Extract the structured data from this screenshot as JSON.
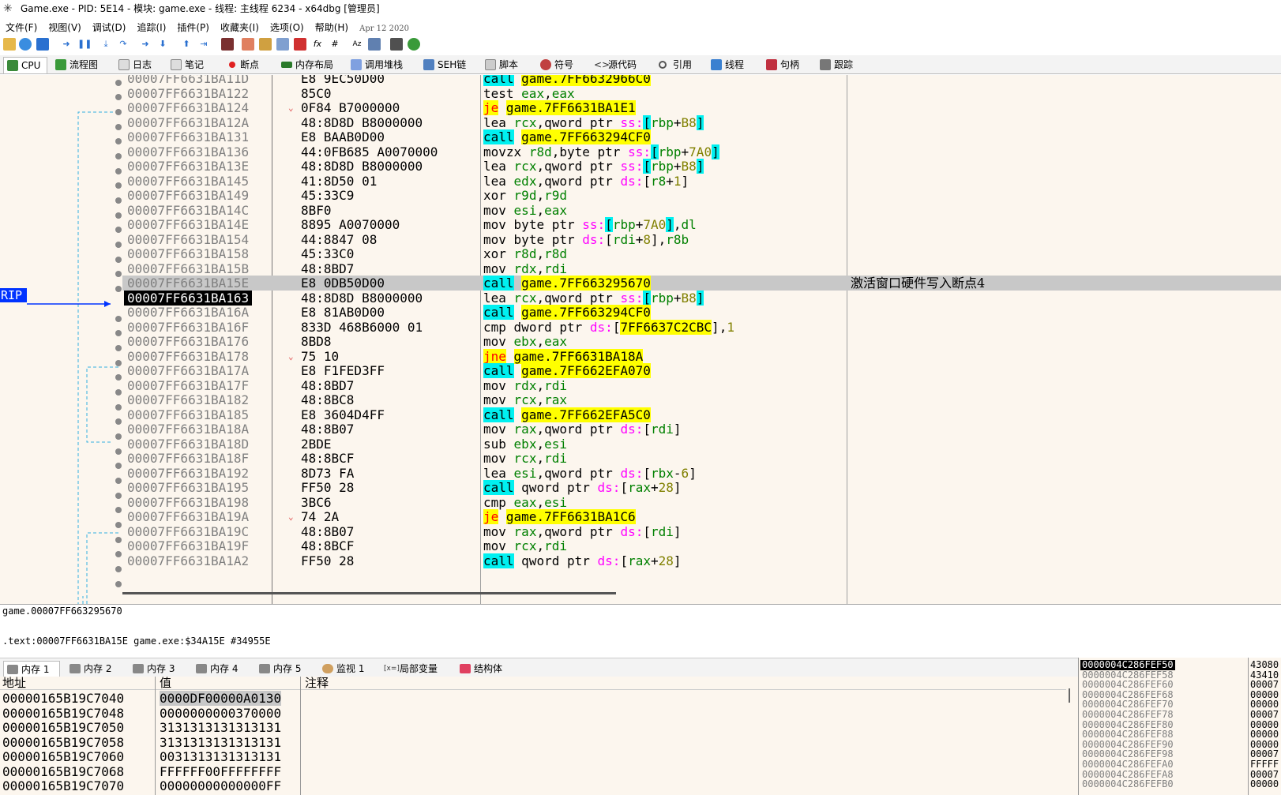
{
  "window": {
    "title": "Game.exe - PID: 5E14 - 模块: game.exe - 线程: 主线程 6234 - x64dbg [管理员]"
  },
  "menu": {
    "items": [
      "文件(F)",
      "视图(V)",
      "调试(D)",
      "追踪(I)",
      "插件(P)",
      "收藏夹(I)",
      "选项(O)",
      "帮助(H)"
    ],
    "date": "Apr 12 2020"
  },
  "tabs": [
    "CPU",
    "流程图",
    "日志",
    "笔记",
    "断点",
    "内存布局",
    "调用堆栈",
    "SEH链",
    "脚本",
    "符号",
    "源代码",
    "引用",
    "线程",
    "句柄",
    "跟踪"
  ],
  "rip_label": "RIP",
  "disasm": [
    {
      "addr": "00007FF6631BA11D",
      "bytes": "E8 9EC50D00",
      "mn": "call",
      "op": "game.7FF6632966C0",
      "kind": "call"
    },
    {
      "addr": "00007FF6631BA122",
      "bytes": "85C0",
      "mn": "test",
      "op": "eax,eax",
      "kind": "plain"
    },
    {
      "addr": "00007FF6631BA124",
      "bytes": "0F84 B7000000",
      "mn": "je",
      "op": "game.7FF6631BA1E1",
      "kind": "jmp",
      "arrow": "v"
    },
    {
      "addr": "00007FF6631BA12A",
      "bytes": "48:8D8D B8000000",
      "mn": "lea",
      "op": "rcx,qword ptr ss:[rbp+B8]",
      "kind": "plain"
    },
    {
      "addr": "00007FF6631BA131",
      "bytes": "E8 BAAB0D00",
      "mn": "call",
      "op": "game.7FF663294CF0",
      "kind": "call"
    },
    {
      "addr": "00007FF6631BA136",
      "bytes": "44:0FB685 A0070000",
      "mn": "movzx",
      "op": "r8d,byte ptr ss:[rbp+7A0]",
      "kind": "plain"
    },
    {
      "addr": "00007FF6631BA13E",
      "bytes": "48:8D8D B8000000",
      "mn": "lea",
      "op": "rcx,qword ptr ss:[rbp+B8]",
      "kind": "plain"
    },
    {
      "addr": "00007FF6631BA145",
      "bytes": "41:8D50 01",
      "mn": "lea",
      "op": "edx,qword ptr ds:[r8+1]",
      "kind": "plain"
    },
    {
      "addr": "00007FF6631BA149",
      "bytes": "45:33C9",
      "mn": "xor",
      "op": "r9d,r9d",
      "kind": "plain"
    },
    {
      "addr": "00007FF6631BA14C",
      "bytes": "8BF0",
      "mn": "mov",
      "op": "esi,eax",
      "kind": "plain"
    },
    {
      "addr": "00007FF6631BA14E",
      "bytes": "8895 A0070000",
      "mn": "mov",
      "op": "byte ptr ss:[rbp+7A0],dl",
      "kind": "plain"
    },
    {
      "addr": "00007FF6631BA154",
      "bytes": "44:8847 08",
      "mn": "mov",
      "op": "byte ptr ds:[rdi+8],r8b",
      "kind": "plain"
    },
    {
      "addr": "00007FF6631BA158",
      "bytes": "45:33C0",
      "mn": "xor",
      "op": "r8d,r8d",
      "kind": "plain"
    },
    {
      "addr": "00007FF6631BA15B",
      "bytes": "48:8BD7",
      "mn": "mov",
      "op": "rdx,rdi",
      "kind": "plain"
    },
    {
      "addr": "00007FF6631BA15E",
      "bytes": "E8 0DB50D00",
      "mn": "call",
      "op": "game.7FF663295670",
      "kind": "call",
      "sel": true,
      "comment": "激活窗口硬件写入断点4"
    },
    {
      "addr": "00007FF6631BA163",
      "bytes": "48:8D8D B8000000",
      "mn": "lea",
      "op": "rcx,qword ptr ss:[rbp+B8]",
      "kind": "plain",
      "cur": true
    },
    {
      "addr": "00007FF6631BA16A",
      "bytes": "E8 81AB0D00",
      "mn": "call",
      "op": "game.7FF663294CF0",
      "kind": "call"
    },
    {
      "addr": "00007FF6631BA16F",
      "bytes": "833D 468B6000 01",
      "mn": "cmp",
      "op": "dword ptr ds:[7FF6637C2CBC],1",
      "kind": "plain"
    },
    {
      "addr": "00007FF6631BA176",
      "bytes": "8BD8",
      "mn": "mov",
      "op": "ebx,eax",
      "kind": "plain"
    },
    {
      "addr": "00007FF6631BA178",
      "bytes": "75 10",
      "mn": "jne",
      "op": "game.7FF6631BA18A",
      "kind": "jmp",
      "arrow": "v"
    },
    {
      "addr": "00007FF6631BA17A",
      "bytes": "E8 F1FED3FF",
      "mn": "call",
      "op": "game.7FF662EFA070",
      "kind": "call"
    },
    {
      "addr": "00007FF6631BA17F",
      "bytes": "48:8BD7",
      "mn": "mov",
      "op": "rdx,rdi",
      "kind": "plain"
    },
    {
      "addr": "00007FF6631BA182",
      "bytes": "48:8BC8",
      "mn": "mov",
      "op": "rcx,rax",
      "kind": "plain"
    },
    {
      "addr": "00007FF6631BA185",
      "bytes": "E8 3604D4FF",
      "mn": "call",
      "op": "game.7FF662EFA5C0",
      "kind": "call"
    },
    {
      "addr": "00007FF6631BA18A",
      "bytes": "48:8B07",
      "mn": "mov",
      "op": "rax,qword ptr ds:[rdi]",
      "kind": "plain"
    },
    {
      "addr": "00007FF6631BA18D",
      "bytes": "2BDE",
      "mn": "sub",
      "op": "ebx,esi",
      "kind": "plain"
    },
    {
      "addr": "00007FF6631BA18F",
      "bytes": "48:8BCF",
      "mn": "mov",
      "op": "rcx,rdi",
      "kind": "plain"
    },
    {
      "addr": "00007FF6631BA192",
      "bytes": "8D73 FA",
      "mn": "lea",
      "op": "esi,qword ptr ds:[rbx-6]",
      "kind": "plain"
    },
    {
      "addr": "00007FF6631BA195",
      "bytes": "FF50 28",
      "mn": "call",
      "op": "qword ptr ds:[rax+28]",
      "kind": "call2"
    },
    {
      "addr": "00007FF6631BA198",
      "bytes": "3BC6",
      "mn": "cmp",
      "op": "eax,esi",
      "kind": "plain"
    },
    {
      "addr": "00007FF6631BA19A",
      "bytes": "74 2A",
      "mn": "je",
      "op": "game.7FF6631BA1C6",
      "kind": "jmp",
      "arrow": "v"
    },
    {
      "addr": "00007FF6631BA19C",
      "bytes": "48:8B07",
      "mn": "mov",
      "op": "rax,qword ptr ds:[rdi]",
      "kind": "plain"
    },
    {
      "addr": "00007FF6631BA19F",
      "bytes": "48:8BCF",
      "mn": "mov",
      "op": "rcx,rdi",
      "kind": "plain"
    },
    {
      "addr": "00007FF6631BA1A2",
      "bytes": "FF50 28",
      "mn": "call",
      "op": "qword ptr ds:[rax+28]",
      "kind": "call2"
    }
  ],
  "info": {
    "line1": "game.00007FF663295670",
    "line2": ".text:00007FF6631BA15E game.exe:$34A15E #34955E"
  },
  "dump_tabs": [
    "内存 1",
    "内存 2",
    "内存 3",
    "内存 4",
    "内存 5",
    "监视 1",
    "局部变量",
    "结构体"
  ],
  "dump_head": {
    "addr": "地址",
    "val": "值",
    "cmt": "注释"
  },
  "dump_rows": [
    {
      "a": "00000165B19C7040",
      "v": "0000DF00000A0130",
      "sel": true
    },
    {
      "a": "00000165B19C7048",
      "v": "0000000000370000"
    },
    {
      "a": "00000165B19C7050",
      "v": "3131313131313131"
    },
    {
      "a": "00000165B19C7058",
      "v": "3131313131313131"
    },
    {
      "a": "00000165B19C7060",
      "v": "0031313131313131"
    },
    {
      "a": "00000165B19C7068",
      "v": "FFFFFF00FFFFFFFF"
    },
    {
      "a": "00000165B19C7070",
      "v": "00000000000000FF"
    }
  ],
  "stack_rows": [
    {
      "a": "0000004C286FEF50",
      "v": "43080",
      "cur": true
    },
    {
      "a": "0000004C286FEF58",
      "v": "43410"
    },
    {
      "a": "0000004C286FEF60",
      "v": "00007"
    },
    {
      "a": "0000004C286FEF68",
      "v": "00000"
    },
    {
      "a": "0000004C286FEF70",
      "v": "00000"
    },
    {
      "a": "0000004C286FEF78",
      "v": "00007"
    },
    {
      "a": "0000004C286FEF80",
      "v": "00000"
    },
    {
      "a": "0000004C286FEF88",
      "v": "00000"
    },
    {
      "a": "0000004C286FEF90",
      "v": "00000"
    },
    {
      "a": "0000004C286FEF98",
      "v": "00007"
    },
    {
      "a": "0000004C286FEFA0",
      "v": "FFFFF"
    },
    {
      "a": "0000004C286FEFA8",
      "v": "00007"
    },
    {
      "a": "0000004C286FEFB0",
      "v": "00000"
    }
  ]
}
